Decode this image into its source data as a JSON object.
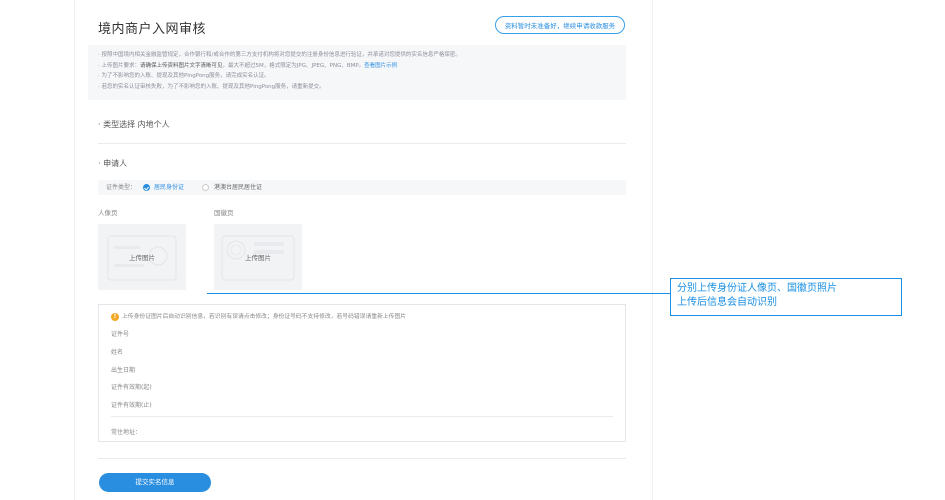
{
  "header": {
    "title": "境内商户入网审核",
    "action_label": "资料暂时未准备好，继续申请收款服务"
  },
  "notice": {
    "line1": "· 按照中国境内相关金融监管规定，合作银行和/或合作的第三方支付机构将对您提交的注册身份信息进行验证，并承诺对您提供的实名信息严格保密。",
    "line2_prefix": "· 上传图片要求：",
    "line2_emph": "请确保上传资料图片文字清晰可见",
    "line2_suffix": "，最大不超过5M，格式限定为JPG、JPEG、PNG、BMP。",
    "line2_link": "查看图片示例",
    "line3": "· 为了不影响您的入账、提现及其他PingPong服务，请完成实名认证。",
    "line4": "· 若您的实名认证审核失败，为了不影响您的入账、提现及其他PingPong服务，请重新提交。"
  },
  "type_section": {
    "label": "· 类型选择 内地个人"
  },
  "applicant": {
    "title": "· 申请人",
    "id_type_label": "证件类型：",
    "options": [
      {
        "label": "居民身份证",
        "selected": true
      },
      {
        "label": "港澳台居民居住证",
        "selected": false
      }
    ],
    "cards": [
      {
        "label": "人像页",
        "upload_text": "上传图片"
      },
      {
        "label": "国徽页",
        "upload_text": "上传图片"
      }
    ]
  },
  "info_box": {
    "warning": "上传身份证图片后自动识别信息，若识别有误请点击修改；身份证号码不支持修改，若号码错误请重新上传图片",
    "fields": [
      "证件号",
      "姓名",
      "出生日期",
      "证件有效期(起)",
      "证件有效期(止)"
    ],
    "address_label": "常住地址："
  },
  "submit_label": "提交实名信息",
  "annotation": {
    "line1": "分别上传身份证人像页、国徽页照片",
    "line2": "上传后信息会自动识别"
  },
  "colors": {
    "accent": "#2a8ee0",
    "annotation": "#1a8fe3",
    "warning": "#f5a623"
  }
}
